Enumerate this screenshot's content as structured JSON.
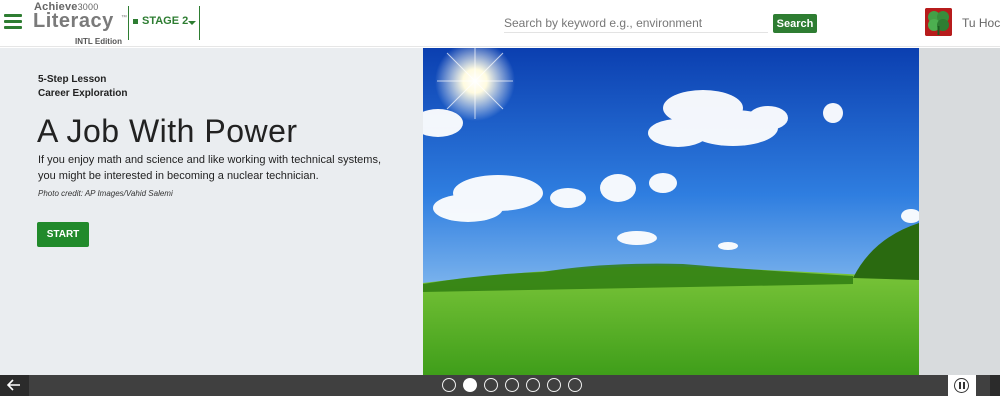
{
  "header": {
    "brand": "Achieve",
    "brand_num": "3000",
    "product": "Literacy",
    "trademark": "™",
    "edition": "INTL Edition",
    "stage_label": "STAGE 2",
    "search_placeholder": "Search by keyword e.g., environment",
    "search_button": "Search",
    "username": "Tu Hoc"
  },
  "lesson": {
    "kicker": "5-Step Lesson",
    "category": "Career Exploration",
    "title": "A Job With Power",
    "summary": "If you enjoy math and science and like working with technical systems, you might be interested in becoming a nuclear technician.",
    "photo_credit": "Photo credit: AP Images/Vahid Salemi",
    "start_button": "START"
  },
  "carousel": {
    "slide_count": 7,
    "active_slide": 2
  },
  "colors": {
    "accent": "#2e7d32",
    "start": "#218a2b",
    "bar": "#404040",
    "panel": "#eaedf0"
  }
}
